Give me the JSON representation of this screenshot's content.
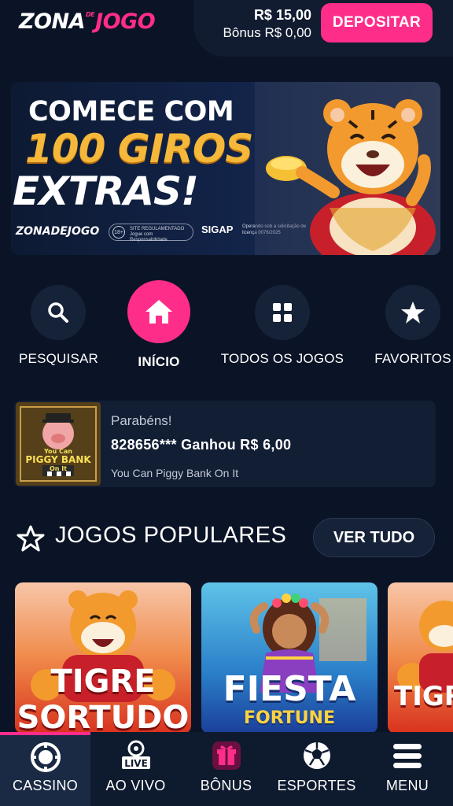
{
  "header": {
    "logo_part1": "ZONA",
    "logo_part2": "DE",
    "logo_part3": "JOGO",
    "balance": "R$ 15,00",
    "bonus_balance": "Bônus R$ 0,00",
    "deposit_label": "DEPOSITAR"
  },
  "banner": {
    "line1": "COMECE COM",
    "line2": "100 GIROS",
    "line3": "EXTRAS!",
    "footer_logo": "ZONADEJOGO",
    "age_badge": "18+",
    "responsible_text": "SITE REGULAMENTADO Jogue com Responsabilidade",
    "sigap": "SIGAP",
    "license_text": "Operando sob a solicitação de licença 0076/2025"
  },
  "quick_nav": [
    {
      "label": "PESQUISAR",
      "icon": "search-icon"
    },
    {
      "label": "INÍCIO",
      "icon": "home-icon",
      "active": true
    },
    {
      "label": "TODOS OS JOGOS",
      "icon": "grid-icon"
    },
    {
      "label": "FAVORITOS",
      "icon": "star-icon"
    }
  ],
  "winner": {
    "congrats": "Parabéns!",
    "message": "828656*** Ganhou R$ 6,00",
    "game": "You Can Piggy Bank On It",
    "thumb_line1": "You Can",
    "thumb_line2": "PIGGY BANK",
    "thumb_line3": "On It"
  },
  "popular": {
    "title": "JOGOS POPULARES",
    "see_all": "VER TUDO",
    "games": [
      {
        "line1": "TIGRE",
        "line2": "SORTUDO"
      },
      {
        "line1": "FIESTA",
        "line2": "FORTUNE"
      },
      {
        "line1": "TIGRE",
        "line2": ""
      }
    ]
  },
  "bottom_nav": [
    {
      "label": "CASSINO",
      "icon": "casino-chip-icon",
      "active": true
    },
    {
      "label": "AO VIVO",
      "icon": "live-icon"
    },
    {
      "label": "BÔNUS",
      "icon": "gift-icon"
    },
    {
      "label": "ESPORTES",
      "icon": "soccer-ball-icon"
    },
    {
      "label": "MENU",
      "icon": "menu-icon"
    }
  ],
  "colors": {
    "background": "#0b1426",
    "accent": "#ff2d8a",
    "card": "#121e34",
    "gold": "#f5b83a"
  }
}
